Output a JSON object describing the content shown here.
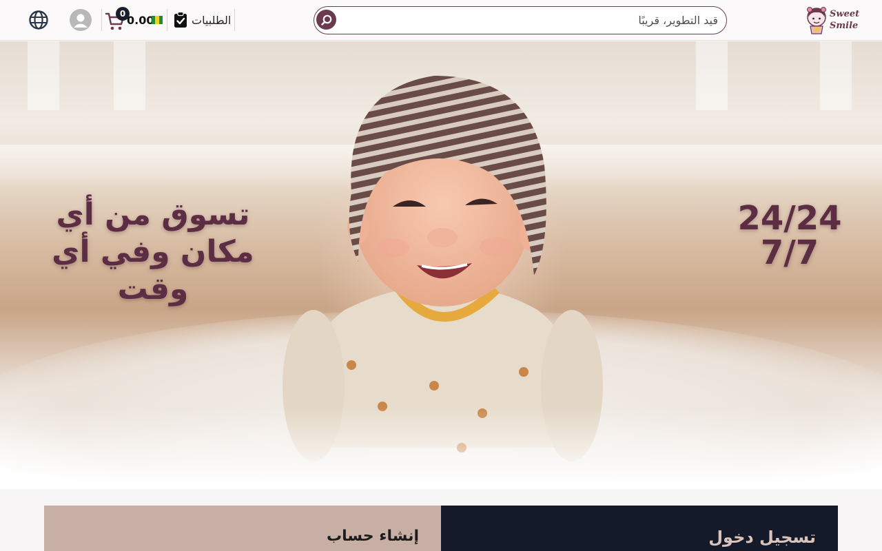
{
  "brand": {
    "logo_line1": "Sweet",
    "logo_line2": "Smile",
    "accent_color": "#6b3a4f",
    "dark_color": "#141a29"
  },
  "header": {
    "search_placeholder": "قيد التطوير، قريبًا",
    "search_icon": "search-icon",
    "orders_label": "الطلبيات",
    "orders_icon": "clipboard-check-icon",
    "cart_count": "0",
    "cart_amount": "0.00",
    "cart_icon": "shopping-cart-icon",
    "currency_icon": "banknote-icon",
    "account_icon": "user-avatar-icon",
    "language_icon": "globe-icon"
  },
  "hero": {
    "tagline": "تسوق من أي مكان وفي أي وقت",
    "hours_line1": "24/24",
    "hours_line2": "7/7"
  },
  "account": {
    "signup_title": "إنشاء حساب",
    "login_title": "تسجيل دخول"
  }
}
